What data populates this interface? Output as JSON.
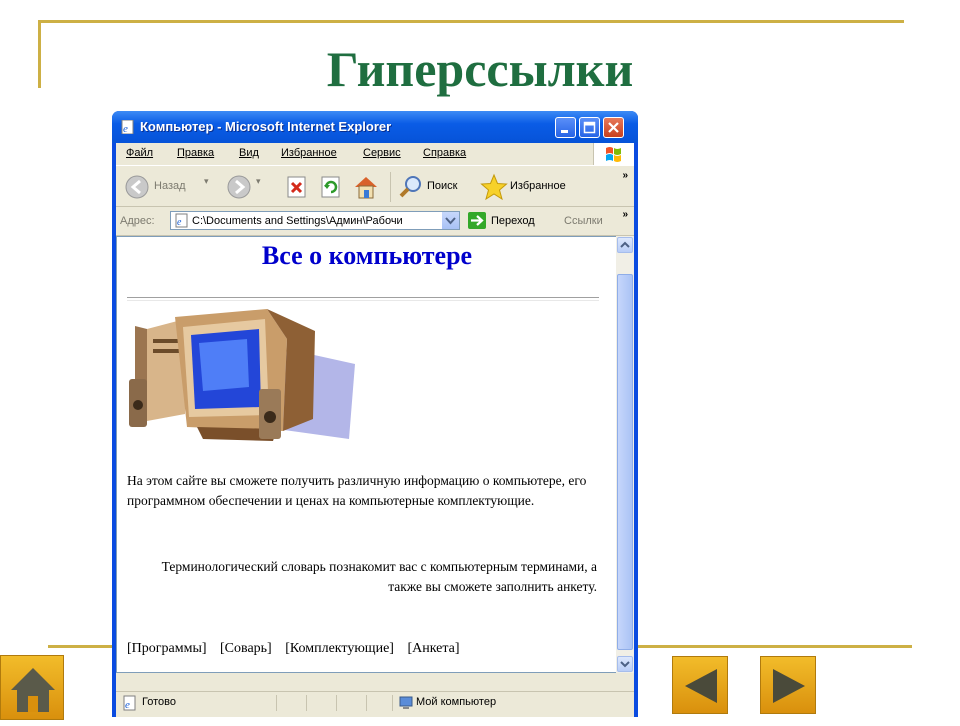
{
  "slide": {
    "title": "Гиперссылки"
  },
  "window": {
    "title": "Компьютер - Microsoft Internet Explorer"
  },
  "menu": [
    "Файл",
    "Правка",
    "Вид",
    "Избранное",
    "Сервис",
    "Справка"
  ],
  "toolbar": {
    "back": "Назад",
    "search": "Поиск",
    "favorites": "Избранное"
  },
  "address": {
    "label": "Адрес:",
    "value": "C:\\Documents and Settings\\Админ\\Рабочи",
    "go": "Переход",
    "links": "Ссылки"
  },
  "page": {
    "heading": "Все о компьютере",
    "para1": "На этом сайте вы сможете получить различную информацию о компьютере, его программном обеспечении и ценах на компьютерные комплектующие.",
    "para2": "Терминологический словарь познакомит вас с компьютерным терминами, а также вы сможете заполнить анкету.",
    "links": [
      "[Программы]",
      "[Соварь]",
      "[Комплектующие]",
      "[Анкета]"
    ]
  },
  "status": {
    "ready": "Готово",
    "zone": "Мой компьютер"
  },
  "colors": {
    "title_green": "#1f6e40",
    "heading_blue": "#0000cc",
    "frame_gold": "#cdb045"
  }
}
